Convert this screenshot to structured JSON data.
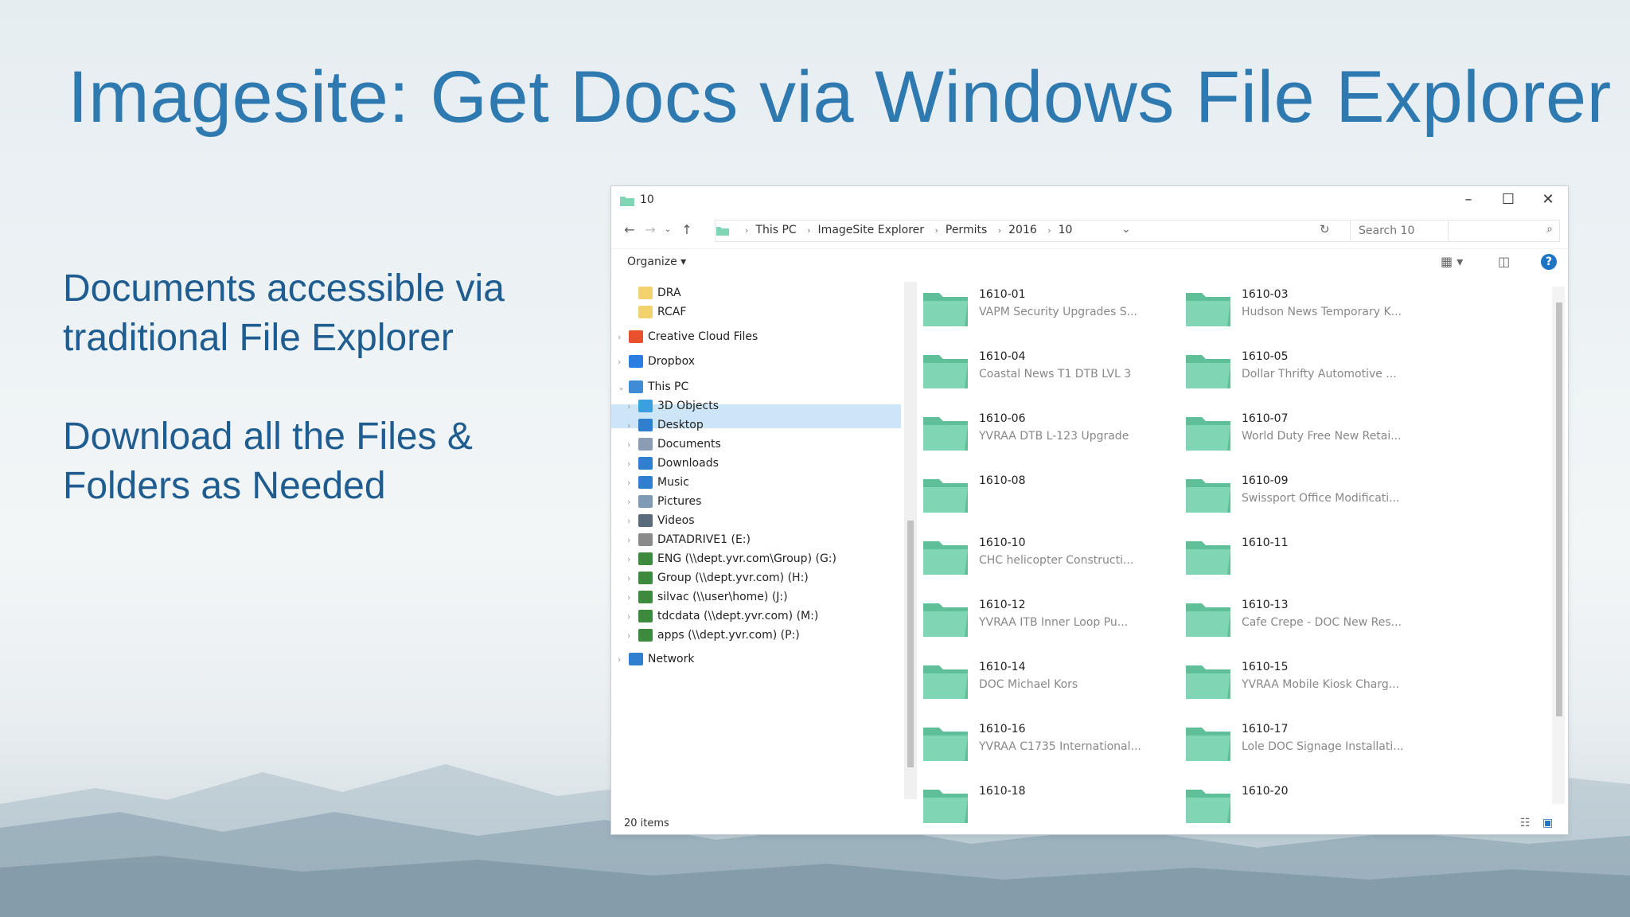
{
  "slide": {
    "title": "Imagesite: Get Docs via Windows File Explorer",
    "bullets": [
      "Documents accessible via traditional File Explorer",
      "Download all the Files & Folders as Needed"
    ]
  },
  "window": {
    "title": "10",
    "controls": {
      "minimize": "–",
      "maximize": "☐",
      "close": "✕"
    },
    "breadcrumbs": [
      "This PC",
      "ImageSite Explorer",
      "Permits",
      "2016",
      "10"
    ],
    "search_placeholder": "Search 10",
    "toolbar": {
      "organize": "Organize"
    },
    "status": "20 items"
  },
  "nav": [
    {
      "label": "DRA",
      "icon": "folder-icon",
      "indent": 1,
      "chev": ""
    },
    {
      "label": "RCAF",
      "icon": "folder-icon",
      "indent": 1,
      "chev": ""
    },
    {
      "label": "Creative Cloud Files",
      "icon": "creative-cloud-icon",
      "indent": 0,
      "chev": ">"
    },
    {
      "label": "Dropbox",
      "icon": "dropbox-icon",
      "indent": 0,
      "chev": ">"
    },
    {
      "label": "This PC",
      "icon": "pc-icon",
      "indent": 0,
      "chev": "v",
      "selected": true
    },
    {
      "label": "3D Objects",
      "icon": "3d-objects-icon",
      "indent": 1,
      "chev": ">"
    },
    {
      "label": "Desktop",
      "icon": "desktop-icon",
      "indent": 1,
      "chev": ">"
    },
    {
      "label": "Documents",
      "icon": "documents-icon",
      "indent": 1,
      "chev": ">"
    },
    {
      "label": "Downloads",
      "icon": "downloads-icon",
      "indent": 1,
      "chev": ">"
    },
    {
      "label": "Music",
      "icon": "music-icon",
      "indent": 1,
      "chev": ">"
    },
    {
      "label": "Pictures",
      "icon": "pictures-icon",
      "indent": 1,
      "chev": ">"
    },
    {
      "label": "Videos",
      "icon": "videos-icon",
      "indent": 1,
      "chev": ">"
    },
    {
      "label": "DATADRIVE1 (E:)",
      "icon": "drive-icon",
      "indent": 1,
      "chev": ">"
    },
    {
      "label": "ENG (\\\\dept.yvr.com\\Group) (G:)",
      "icon": "network-drive-icon",
      "indent": 1,
      "chev": ">"
    },
    {
      "label": "Group (\\\\dept.yvr.com) (H:)",
      "icon": "network-drive-icon",
      "indent": 1,
      "chev": ">"
    },
    {
      "label": "silvac (\\\\user\\home) (J:)",
      "icon": "network-drive-icon",
      "indent": 1,
      "chev": ">"
    },
    {
      "label": "tdcdata (\\\\dept.yvr.com) (M:)",
      "icon": "network-drive-icon",
      "indent": 1,
      "chev": ">"
    },
    {
      "label": "apps (\\\\dept.yvr.com) (P:)",
      "icon": "network-drive-icon",
      "indent": 1,
      "chev": ">"
    },
    {
      "label": "Network",
      "icon": "network-icon",
      "indent": 0,
      "chev": ">"
    }
  ],
  "folders": [
    {
      "name": "1610-01",
      "desc": "VAPM Security Upgrades S..."
    },
    {
      "name": "1610-03",
      "desc": "Hudson News Temporary K..."
    },
    {
      "name": "1610-04",
      "desc": "Coastal News T1 DTB LVL 3"
    },
    {
      "name": "1610-05",
      "desc": "Dollar Thrifty Automotive ..."
    },
    {
      "name": "1610-06",
      "desc": "YVRAA DTB L-123 Upgrade"
    },
    {
      "name": "1610-07",
      "desc": "World Duty Free New Retai..."
    },
    {
      "name": "1610-08",
      "desc": ""
    },
    {
      "name": "1610-09",
      "desc": "Swissport Office Modificati..."
    },
    {
      "name": "1610-10",
      "desc": "CHC helicopter Constructi..."
    },
    {
      "name": "1610-11",
      "desc": ""
    },
    {
      "name": "1610-12",
      "desc": "YVRAA ITB Inner Loop Pu..."
    },
    {
      "name": "1610-13",
      "desc": "Cafe Crepe - DOC New Res..."
    },
    {
      "name": "1610-14",
      "desc": "DOC Michael Kors"
    },
    {
      "name": "1610-15",
      "desc": "YVRAA Mobile Kiosk Charg..."
    },
    {
      "name": "1610-16",
      "desc": "YVRAA C1735 International..."
    },
    {
      "name": "1610-17",
      "desc": "Lole DOC Signage Installati..."
    },
    {
      "name": "1610-18",
      "desc": ""
    },
    {
      "name": "1610-20",
      "desc": ""
    }
  ],
  "colors": {
    "title": "#2e7ab0",
    "body_text": "#1f5c8f",
    "selection": "#cde6f7",
    "folder": "#7fd6b4"
  }
}
